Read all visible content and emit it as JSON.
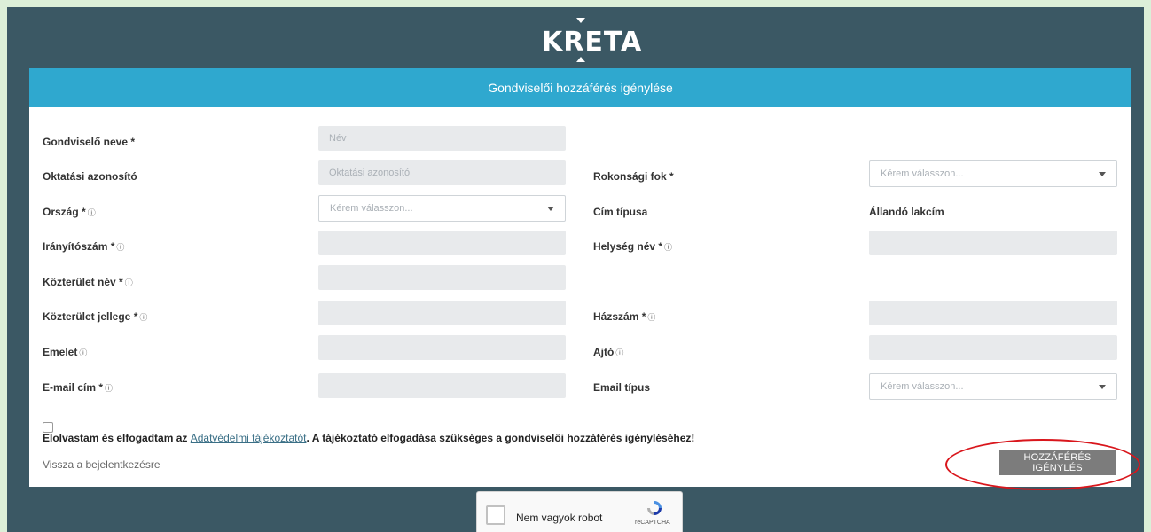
{
  "brand": {
    "logo_text": "KRETA"
  },
  "form": {
    "title": "Gondviselői hozzáférés igénylése",
    "fields": {
      "guardian_name": {
        "label": "Gondviselő neve *",
        "placeholder": "Név"
      },
      "edu_id": {
        "label": "Oktatási azonosító",
        "placeholder": "Oktatási azonosító"
      },
      "relation": {
        "label": "Rokonsági fok *",
        "placeholder": "Kérem válasszon..."
      },
      "country": {
        "label": "Ország *",
        "placeholder": "Kérem válasszon..."
      },
      "address_type": {
        "label": "Cím típusa",
        "value": "Állandó lakcím"
      },
      "zip": {
        "label": "Irányítószám *"
      },
      "city": {
        "label": "Helység név *"
      },
      "street_name": {
        "label": "Közterület név *"
      },
      "street_type": {
        "label": "Közterület jellege *"
      },
      "house_no": {
        "label": "Házszám *"
      },
      "floor": {
        "label": "Emelet"
      },
      "door": {
        "label": "Ajtó"
      },
      "email": {
        "label": "E-mail cím *"
      },
      "email_type": {
        "label": "Email típus",
        "placeholder": "Kérem válasszon..."
      }
    },
    "info_glyph": "ⓘ",
    "consent": {
      "prefix": "Elolvastam és elfogadtam az ",
      "link": "Adatvédelmi tájékoztatót",
      "suffix": ". A tájékoztató elfogadása szükséges a gondviselői hozzáférés igényléséhez!"
    },
    "back_link": "Vissza a bejelentkezésre",
    "submit_label": "HOZZÁFÉRÉS IGÉNYLÉS"
  },
  "captcha": {
    "label": "Nem vagyok robot",
    "brand": "reCAPTCHA"
  },
  "colors": {
    "header": "#2fa8cf",
    "background": "#3b5864",
    "highlight": "#d9161c"
  }
}
